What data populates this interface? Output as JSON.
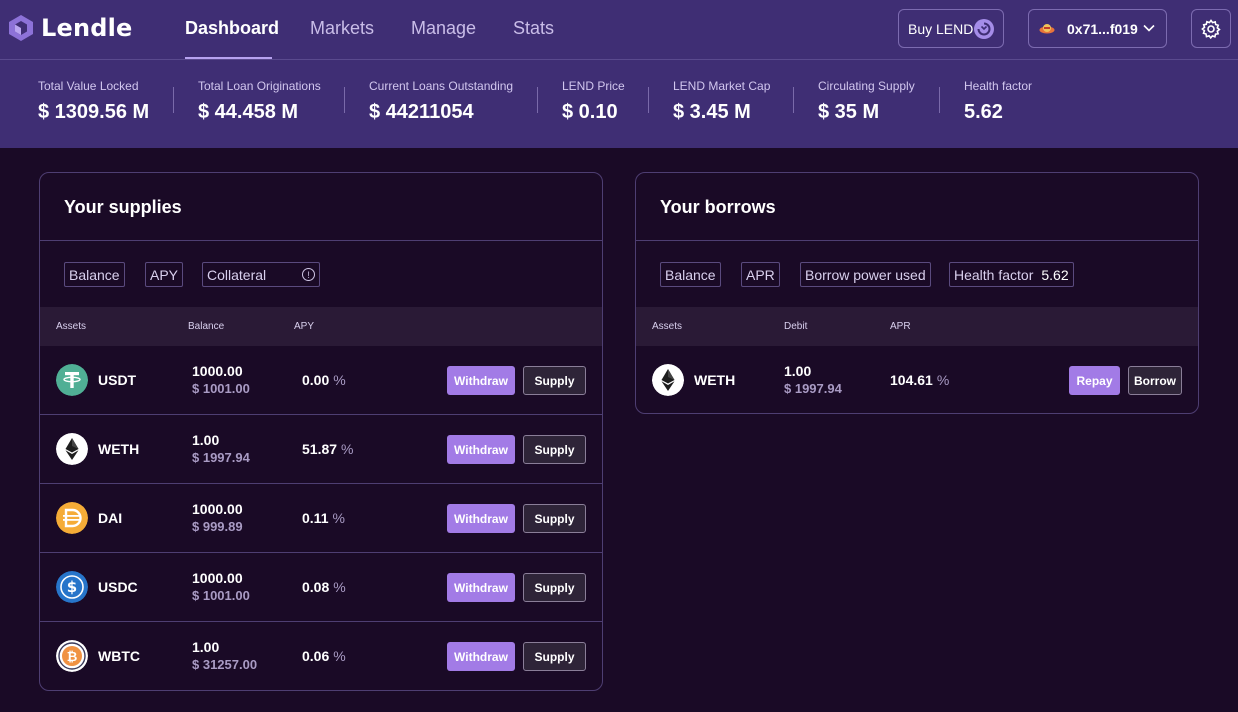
{
  "app": {
    "name": "Lendle"
  },
  "nav": {
    "dashboard": "Dashboard",
    "markets": "Markets",
    "manage": "Manage",
    "stats": "Stats"
  },
  "header": {
    "buy_label": "Buy LEND",
    "wallet_address": "0x71...f019"
  },
  "stats": [
    {
      "label": "Total Value Locked",
      "value": "$ 1309.56 M"
    },
    {
      "label": "Total Loan Originations",
      "value": "$ 44.458 M"
    },
    {
      "label": "Current Loans Outstanding",
      "value": "$ 44211054"
    },
    {
      "label": "LEND Price",
      "value": "$ 0.10"
    },
    {
      "label": "LEND Market Cap",
      "value": "$ 3.45 M"
    },
    {
      "label": "Circulating Supply",
      "value": "$ 35 M"
    },
    {
      "label": "Health factor",
      "value": "5.62"
    }
  ],
  "supplies": {
    "title": "Your supplies",
    "chips": {
      "balance": "Balance",
      "apy": "APY",
      "collateral": "Collateral",
      "info": "!"
    },
    "columns": {
      "assets": "Assets",
      "balance": "Balance",
      "apy": "APY"
    },
    "rows": [
      {
        "symbol": "USDT",
        "amount": "1000.00",
        "usd": "$ 1001.00",
        "apy": "0.00",
        "pct": "%",
        "withdraw": "Withdraw",
        "supply": "Supply"
      },
      {
        "symbol": "WETH",
        "amount": "1.00",
        "usd": "$ 1997.94",
        "apy": "51.87",
        "pct": "%",
        "withdraw": "Withdraw",
        "supply": "Supply"
      },
      {
        "symbol": "DAI",
        "amount": "1000.00",
        "usd": "$ 999.89",
        "apy": "0.11",
        "pct": "%",
        "withdraw": "Withdraw",
        "supply": "Supply"
      },
      {
        "symbol": "USDC",
        "amount": "1000.00",
        "usd": "$ 1001.00",
        "apy": "0.08",
        "pct": "%",
        "withdraw": "Withdraw",
        "supply": "Supply"
      },
      {
        "symbol": "WBTC",
        "amount": "1.00",
        "usd": "$ 31257.00",
        "apy": "0.06",
        "pct": "%",
        "withdraw": "Withdraw",
        "supply": "Supply"
      }
    ]
  },
  "borrows": {
    "title": "Your borrows",
    "chips": {
      "balance": "Balance",
      "apr": "APR",
      "borrow_power": "Borrow power used",
      "health_label": "Health factor",
      "health_value": "5.62"
    },
    "columns": {
      "assets": "Assets",
      "debit": "Debit",
      "apr": "APR"
    },
    "rows": [
      {
        "symbol": "WETH",
        "amount": "1.00",
        "usd": "$ 1997.94",
        "apr": "104.61",
        "pct": "%",
        "repay": "Repay",
        "borrow": "Borrow"
      }
    ]
  },
  "icons": {
    "logo": "lendle-logo-icon",
    "buy": "lend-token-icon",
    "wallet": "wallet-avatar-icon",
    "chevron": "chevron-down-icon",
    "settings": "gear-icon"
  },
  "colors": {
    "nav_bg": "#3f2e74",
    "page_bg": "#1a0a26",
    "accent": "#a27be6",
    "usdt": "#50af95",
    "dai": "#f5ac37",
    "usdc": "#2775ca",
    "wbtc": "#f09242"
  }
}
